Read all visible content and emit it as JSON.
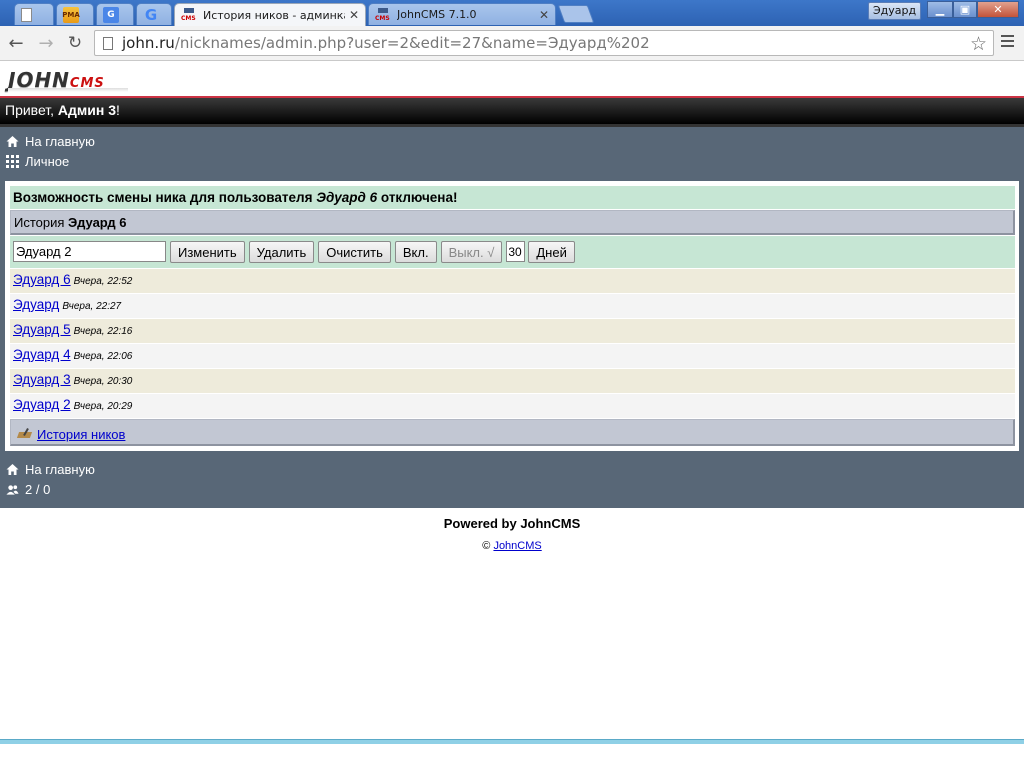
{
  "browser": {
    "tabs": [
      {
        "title": "",
        "icon": "document-icon"
      },
      {
        "title": "",
        "icon": "phpmyadmin-icon",
        "icon_text": "PMA"
      },
      {
        "title": "",
        "icon": "google-translate-icon",
        "icon_text": "G"
      },
      {
        "title": "",
        "icon": "google-icon",
        "icon_text": "G"
      },
      {
        "title": "История ников - админка",
        "icon": "johncms-icon",
        "active": true
      },
      {
        "title": "JohnCMS 7.1.0",
        "icon": "johncms-icon"
      }
    ],
    "favicon_text": "CMS",
    "close_glyph": "✕",
    "profile_name": "Эдуард",
    "window_buttons": {
      "minimize": "▁",
      "maximize": "▣",
      "close": "✕"
    },
    "nav": {
      "back": "←",
      "forward": "→",
      "reload": "↻",
      "star": "☆"
    },
    "url_host": "john.ru",
    "url_path": "/nicknames/admin.php?user=2&edit=27&name=Эдуард%202"
  },
  "site": {
    "logo_main": "JOHN",
    "logo_sub": "CMS",
    "greeting_prefix": "Привет, ",
    "greeting_user": "Админ 3",
    "greeting_suffix": "!",
    "top_links": [
      {
        "label": "На главную",
        "icon": "home-icon"
      },
      {
        "label": "Личное",
        "icon": "grid-icon"
      }
    ],
    "notice_prefix": "Возможность смены ника для пользователя ",
    "notice_user": "Эдуард 6",
    "notice_suffix": " отключена!",
    "history_prefix": "История ",
    "history_user": "Эдуард 6",
    "form": {
      "nick_value": "Эдуард 2",
      "buttons": {
        "change": "Изменить",
        "delete": "Удалить",
        "clear": "Очистить",
        "enable": "Вкл.",
        "disable": "Выкл. √"
      },
      "days_value": "30",
      "days_button": "Дней"
    },
    "history": [
      {
        "nick": "Эдуард 6",
        "time": "Вчера, 22:52"
      },
      {
        "nick": "Эдуард",
        "time": "Вчера, 22:27"
      },
      {
        "nick": "Эдуард 5",
        "time": "Вчера, 22:16"
      },
      {
        "nick": "Эдуард 4",
        "time": "Вчера, 22:06"
      },
      {
        "nick": "Эдуард 3",
        "time": "Вчера, 20:30"
      },
      {
        "nick": "Эдуард 2",
        "time": "Вчера, 20:29"
      }
    ],
    "footer_link": "История ников",
    "bottom_links": [
      {
        "label": "На главную",
        "icon": "home-icon"
      },
      {
        "label": "2 / 0",
        "icon": "users-icon"
      }
    ],
    "powered": "Powered by JohnCMS",
    "copyright_symbol": "© ",
    "copyright_link": "JohnCMS"
  },
  "colors": {
    "dark_bg": "#586777",
    "notice_bg": "#c6e6d4",
    "header_bar_bg": "#c2c7d3",
    "row_odd": "#eeebdb",
    "row_even": "#f4f4f4",
    "link": "#0000cc"
  }
}
